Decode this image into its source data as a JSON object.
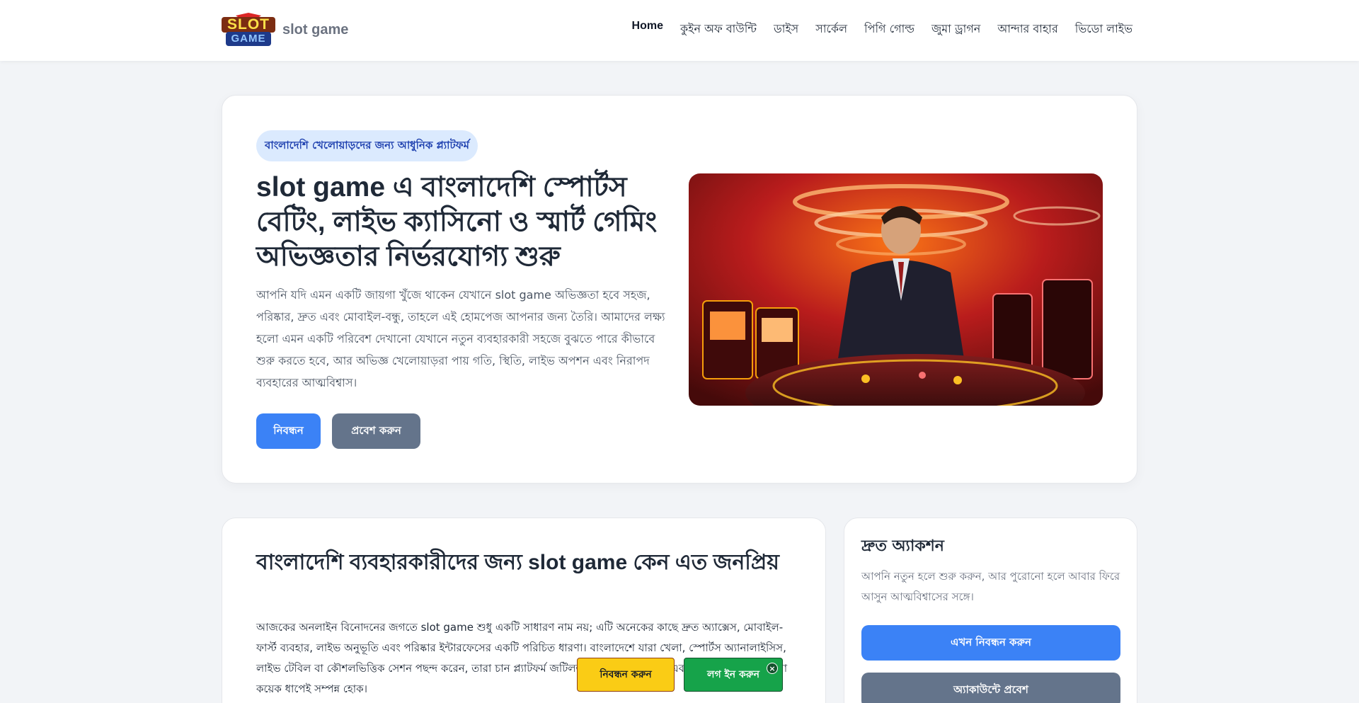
{
  "brand": {
    "logo_text_top": "SLOT",
    "logo_text_bottom": "GAME",
    "name": "slot game"
  },
  "nav": {
    "items": [
      {
        "label": "Home"
      },
      {
        "label": "কুইন অফ বাউন্টি"
      },
      {
        "label": "ডাইস"
      },
      {
        "label": "সার্কেল"
      },
      {
        "label": "পিগি গোল্ড"
      },
      {
        "label": "জুমা ড্রাগন"
      },
      {
        "label": "আন্দার বাহার"
      },
      {
        "label": "ভিডো লাইভ"
      }
    ]
  },
  "hero": {
    "pill": "বাংলাদেশি খেলোয়াড়দের জন্য আধুনিক প্ল্যাটফর্ম",
    "title": "slot game এ বাংলাদেশি স্পোর্টস বেটিং, লাইভ ক্যাসিনো ও স্মার্ট গেমিং অভিজ্ঞতার নির্ভরযোগ্য শুরু",
    "description": "আপনি যদি এমন একটি জায়গা খুঁজে থাকেন যেখানে slot game অভিজ্ঞতা হবে সহজ, পরিষ্কার, দ্রুত এবং মোবাইল-বন্ধু, তাহলে এই হোমপেজ আপনার জন্য তৈরি। আমাদের লক্ষ্য হলো এমন একটি পরিবেশ দেখানো যেখানে নতুন ব্যবহারকারী সহজে বুঝতে পারে কীভাবে শুরু করতে হবে, আর অভিজ্ঞ খেলোয়াড়রা পায় গতি, স্থিতি, লাইভ অপশন এবং নিরাপদ ব্যবহারের আত্মবিশ্বাস।",
    "register_label": "নিবন্ধন",
    "login_label": "প্রবেশ করুন"
  },
  "content": {
    "title": "বাংলাদেশি ব্যবহারকারীদের জন্য slot game কেন এত জনপ্রিয়",
    "text": "আজকের অনলাইন বিনোদনের জগতে slot game শুধু একটি সাধারণ নাম নয়; এটি অনেকের কাছে দ্রুত অ্যাক্সেস, মোবাইল-ফার্স্ট ব্যবহার, লাইভ অনুভূতি এবং পরিষ্কার ইন্টারফেসের একটি পরিচিত ধারণা। বাংলাদেশে যারা খেলা, স্পোর্টস অ্যানালাইসিস, লাইভ টেবিল বা কৌশলভিত্তিক সেশন পছন্দ করেন, তারা চান প্ল্যাটফর্ম জটিলতা কম, তথ্য পরিষ্কার, এবং প্রয়োজনীয় কাজগুলো কয়েক ধাপেই সম্পন্ন হোক।"
  },
  "quick_actions": {
    "title": "দ্রুত অ্যাকশন",
    "text": "আপনি নতুন হলে শুরু করুন, আর পুরোনো হলে আবার ফিরে আসুন আত্মবিশ্বাসের সঙ্গে।",
    "register_now": "এখন নিবন্ধন করুন",
    "account_login": "অ্যাকাউন্টে প্রবেশ"
  },
  "floating": {
    "register": "নিবন্ধন করুন",
    "login": "লগ ইন করুন",
    "close": "×"
  },
  "colors": {
    "primary": "#3b82f6",
    "secondary": "#64748b",
    "float_register": "#facc15",
    "float_login": "#16a34a"
  }
}
